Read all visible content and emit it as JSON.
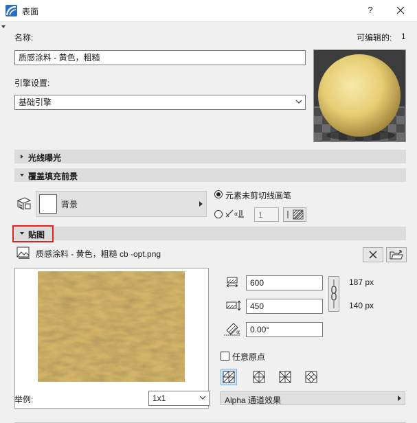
{
  "window": {
    "title": "表面",
    "help_label": "?"
  },
  "header": {
    "name_label": "名称:",
    "editable_label": "可编辑的:",
    "editable_count": "1",
    "name_value": "质感涂料 - 黄色，粗糙",
    "engine_label": "引擎设置:",
    "engine_value": "基础引擎"
  },
  "sections": {
    "light": "光线曝光",
    "cover_fill": "覆盖填充前景",
    "texture": "贴图"
  },
  "cover_fill": {
    "fill_name": "背景",
    "radio_uncut_label": "元素未剪切线画笔",
    "pen_number": "1"
  },
  "texture": {
    "file_name": "质感涂料 - 黄色，粗糙 cb -opt.png",
    "width_value": "600",
    "height_value": "450",
    "width_px": "187 px",
    "height_px": "140 px",
    "angle_value": "0.00°",
    "random_origin_label": "任意原点",
    "example_label": "举例:",
    "example_value": "1x1",
    "alpha_label": "Alpha 通道效果"
  }
}
